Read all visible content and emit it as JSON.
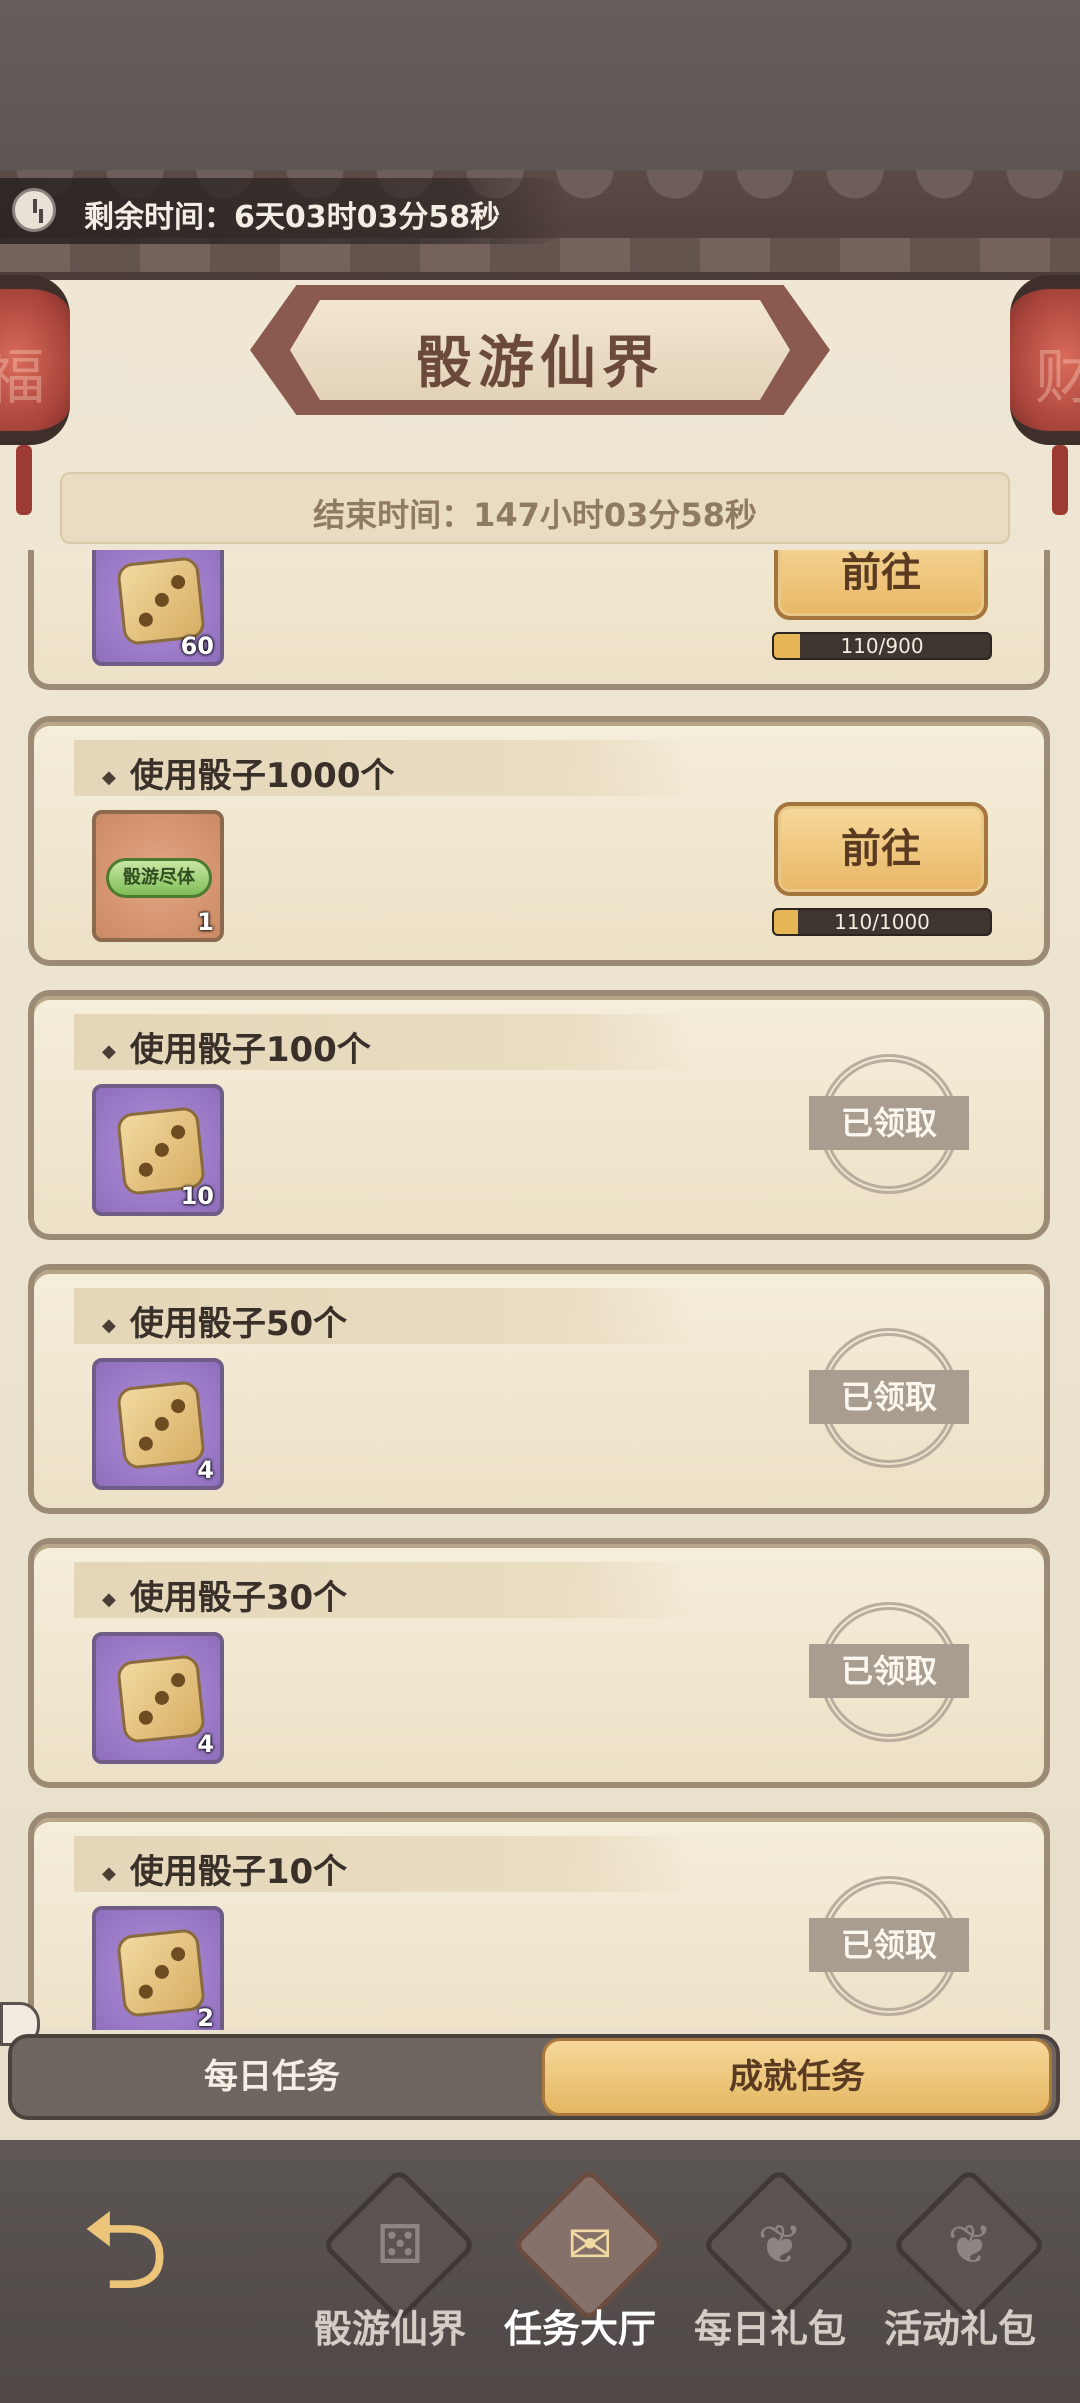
{
  "header": {
    "timer_label": "剩余时间：6天03时03分58秒",
    "title": "骰游仙界",
    "end_time": "结束时间：147小时03分58秒"
  },
  "tasks": [
    {
      "title": "",
      "reward_type": "dice",
      "reward_qty": "60",
      "status": "go",
      "button_label": "前往",
      "progress_text": "110/900",
      "progress": 0.122
    },
    {
      "title": "使用骰子1000个",
      "reward_type": "scroll",
      "reward_label": "骰游尽体",
      "reward_qty": "1",
      "status": "go",
      "button_label": "前往",
      "progress_text": "110/1000",
      "progress": 0.11
    },
    {
      "title": "使用骰子100个",
      "reward_type": "dice",
      "reward_qty": "10",
      "status": "claimed",
      "stamp_label": "已领取"
    },
    {
      "title": "使用骰子50个",
      "reward_type": "dice",
      "reward_qty": "4",
      "status": "claimed",
      "stamp_label": "已领取"
    },
    {
      "title": "使用骰子30个",
      "reward_type": "dice",
      "reward_qty": "4",
      "status": "claimed",
      "stamp_label": "已领取"
    },
    {
      "title": "使用骰子10个",
      "reward_type": "dice",
      "reward_qty": "2",
      "status": "claimed",
      "stamp_label": "已领取"
    }
  ],
  "tabs": {
    "daily": "每日任务",
    "achievement": "成就任务",
    "selected": "achievement"
  },
  "nav": [
    {
      "label": "骰游仙界",
      "icon": "dice-icon",
      "active": false
    },
    {
      "label": "任务大厅",
      "icon": "scroll-icon",
      "active": true
    },
    {
      "label": "每日礼包",
      "icon": "gift-bag-icon",
      "active": false
    },
    {
      "label": "活动礼包",
      "icon": "gift-bag-icon",
      "active": false
    }
  ],
  "colors": {
    "accent": "#e8b765",
    "claimed": "#a89d8e",
    "panel": "#efe7d4"
  }
}
